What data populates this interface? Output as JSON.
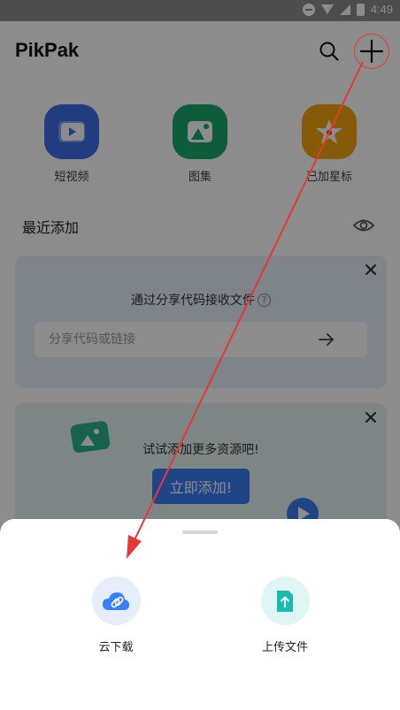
{
  "status_bar": {
    "time": "4:49"
  },
  "header": {
    "brand": "PikPak"
  },
  "quick_access": [
    {
      "label": "短视频",
      "icon": "video-icon",
      "color": "#3c6fe8"
    },
    {
      "label": "图集",
      "icon": "image-icon",
      "color": "#1aa86a"
    },
    {
      "label": "已加星标",
      "icon": "star-icon",
      "color": "#f3a611"
    }
  ],
  "recent": {
    "title": "最近添加"
  },
  "share_card": {
    "hint": "通过分享代码接收文件",
    "help": "?",
    "input_placeholder": "分享代码或链接",
    "input_value": ""
  },
  "promo_card": {
    "tip": "试试添加更多资源吧!",
    "cta": "立即添加!"
  },
  "sheet": {
    "actions": [
      {
        "label": "云下载",
        "icon": "cloud-link-icon",
        "bg": "#e6eefc",
        "fg": "#3a7ff5"
      },
      {
        "label": "上传文件",
        "icon": "upload-file-icon",
        "bg": "#e0f6f4",
        "fg": "#18bcae"
      }
    ]
  },
  "colors": {
    "accent": "#3a7ff5",
    "annotation": "#e53935"
  }
}
